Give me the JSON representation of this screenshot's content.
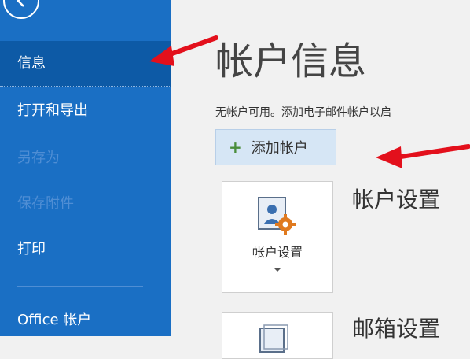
{
  "sidebar": {
    "items": [
      {
        "label": "信息"
      },
      {
        "label": "打开和导出"
      },
      {
        "label": "另存为"
      },
      {
        "label": "保存附件"
      },
      {
        "label": "打印"
      },
      {
        "label": "Office 帐户"
      }
    ]
  },
  "main": {
    "title": "帐户信息",
    "description": "无帐户可用。添加电子邮件帐户以启",
    "add_account_label": "添加帐户",
    "account_settings_card_label": "帐户设置",
    "account_settings_heading": "帐户设置",
    "mailbox_settings_heading": "邮箱设置"
  },
  "colors": {
    "sidebar_bg": "#1a6fc4",
    "sidebar_active": "#0d5aa6",
    "arrow": "#e3101c"
  },
  "icons": [
    "back-arrow-icon",
    "plus-icon",
    "account-settings-icon",
    "dropdown-caret-icon",
    "mailbox-icon"
  ]
}
